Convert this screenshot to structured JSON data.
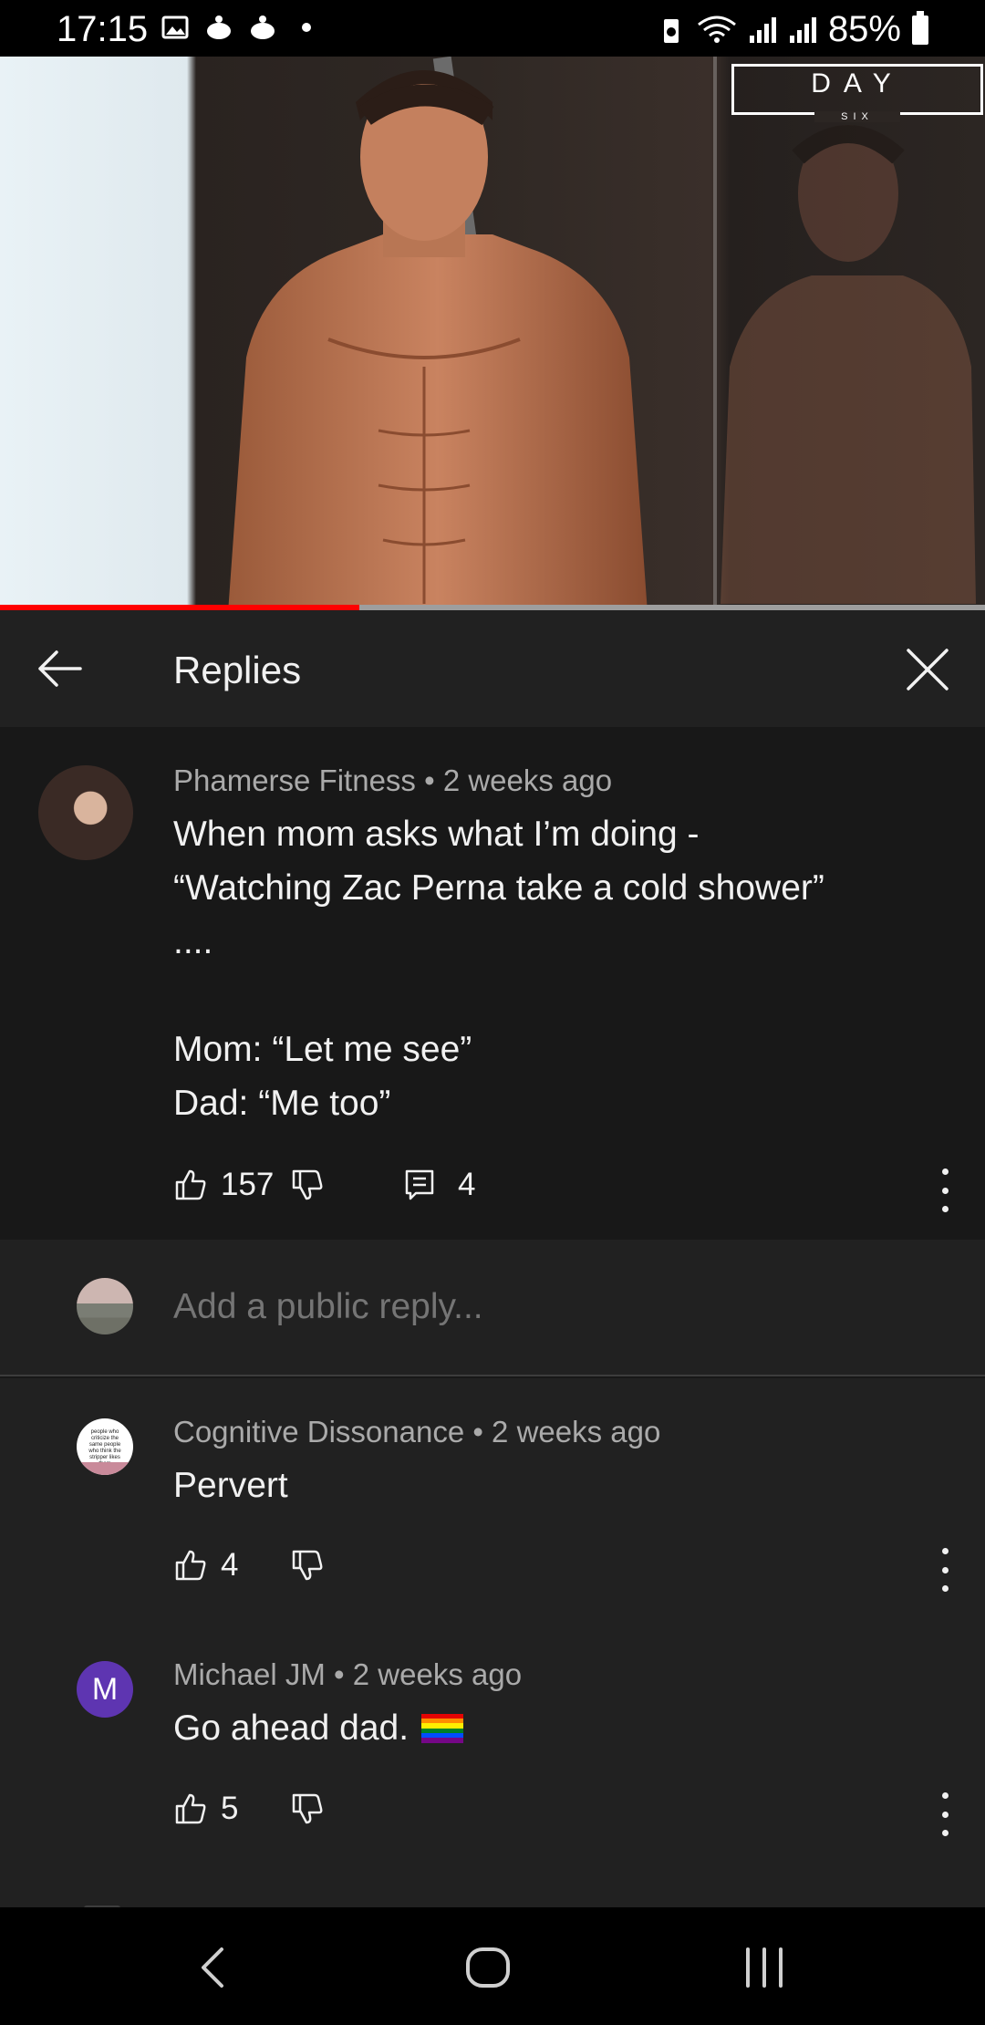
{
  "status_bar": {
    "time": "17:15",
    "battery": "85%",
    "left_icons": [
      "gallery-icon",
      "notification-icon",
      "notification-icon",
      "dot-icon"
    ],
    "right_icons": [
      "battery-saver-icon",
      "wifi-icon",
      "signal-icon",
      "signal-icon",
      "battery-icon"
    ]
  },
  "video": {
    "brand_word": "DAY",
    "brand_sub": "SIX",
    "progress": 0.365,
    "progress_color": "#ff0000"
  },
  "header": {
    "title": "Replies",
    "back_icon": "arrow-left-icon",
    "close_icon": "close-icon"
  },
  "main_comment": {
    "author": "Phamerse Fitness",
    "time": "2 weeks ago",
    "meta": "Phamerse Fitness • 2 weeks ago",
    "text": "When mom asks what I’m doing -\n“Watching Zac Perna take a cold shower”\n....\n\nMom: “Let me see”\nDad: “Me too”",
    "likes": "157",
    "replies": "4"
  },
  "add_reply": {
    "placeholder": "Add a public reply..."
  },
  "replies": [
    {
      "author": "Cognitive Dissonance",
      "time": "2 weeks ago",
      "meta": "Cognitive Dissonance • 2 weeks ago",
      "text": "Pervert",
      "likes": "4",
      "avatar_text": "people who criticize the same people who think the stripper likes them"
    },
    {
      "author": "Michael JM",
      "time": "2 weeks ago",
      "meta": "Michael JM • 2 weeks ago",
      "text": "Go ahead dad.",
      "likes": "5",
      "avatar_letter": "M",
      "avatar_color": "#5e35b1",
      "emoji": "rainbow-flag-icon"
    }
  ],
  "colors": {
    "background": "#181818",
    "panel": "#212121",
    "text": "#f1f1f1",
    "secondary_text": "#aaaaaa"
  },
  "navbar": {
    "icons": [
      "back-icon",
      "home-icon",
      "recents-icon"
    ]
  }
}
